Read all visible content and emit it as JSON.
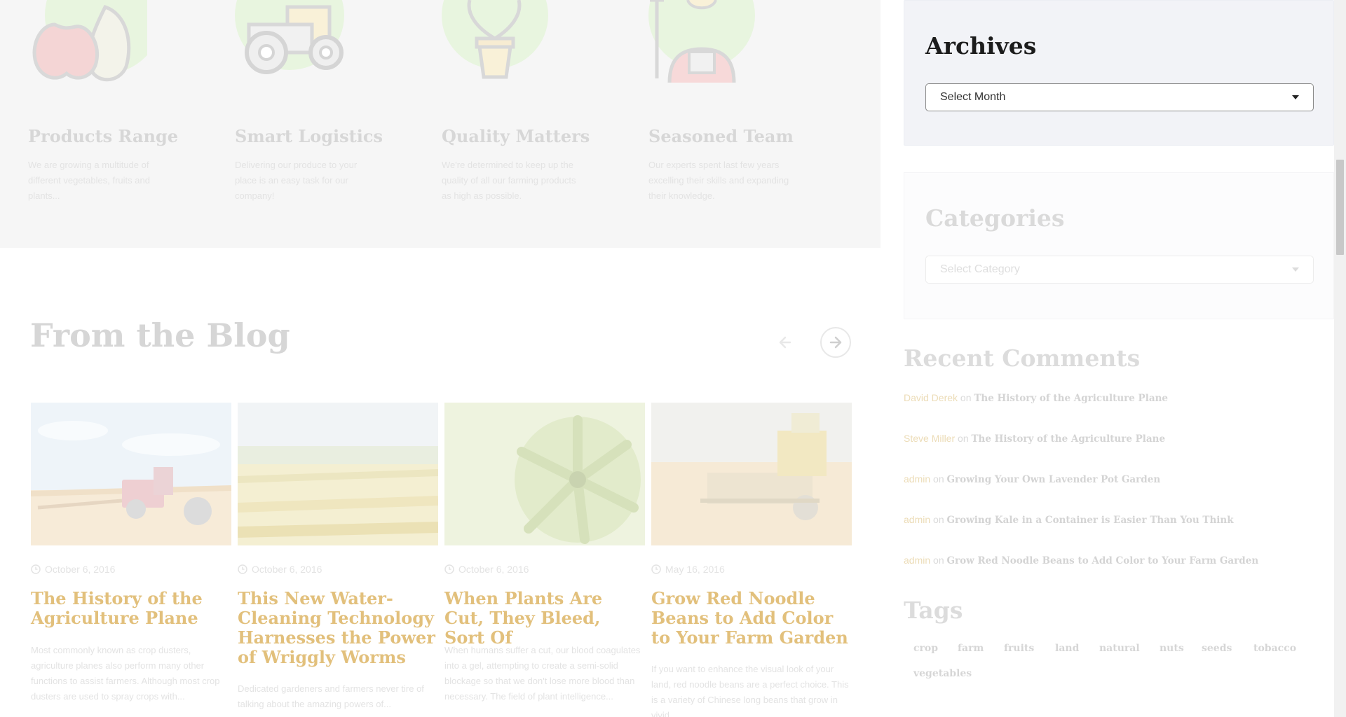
{
  "features": [
    {
      "icon": "fruit-icon",
      "title": "Products Range",
      "text": "We are growing a multitude of different vegetables, fruits and plants..."
    },
    {
      "icon": "tractor-icon",
      "title": "Smart Logistics",
      "text": "Delivering our produce to your place is an easy task for our company!"
    },
    {
      "icon": "potted-plant-icon",
      "title": "Quality Matters",
      "text": "We're determined to keep up the quality of all our farming products as high as possible."
    },
    {
      "icon": "farmer-icon",
      "title": "Seasoned Team",
      "text": "Our experts spent last few years excelling their skills and expanding their knowledge."
    }
  ],
  "blog": {
    "title": "From the Blog",
    "posts": [
      {
        "date": "October 6, 2016",
        "title": "The History of the Agriculture Plane",
        "excerpt": "Most commonly known as crop dusters, agriculture planes also perform many other functions to assist farmers. Although most crop dusters are used to spray crops with..."
      },
      {
        "date": "October 6, 2016",
        "title": "This New Water-Cleaning Technology Harnesses the Power of Wriggly Worms",
        "excerpt": "Dedicated gardeners and farmers never tire of talking about the amazing powers of..."
      },
      {
        "date": "October 6, 2016",
        "title": "When Plants Are Cut, They Bleed, Sort Of",
        "excerpt": "When humans suffer a cut, our blood coagulates into a gel, attempting to create a semi-solid blockage so that we don't lose more blood than necessary. The field of plant intelligence..."
      },
      {
        "date": "May 16, 2016",
        "title": "Grow Red Noodle Beans to Add Color to Your Farm Garden",
        "excerpt": "If you want to enhance the visual look of your land, red noodle beans are a perfect choice. This is a variety of Chinese long beans that grow in vivid..."
      }
    ]
  },
  "sidebar": {
    "archives": {
      "title": "Archives",
      "select_value": "Select Month"
    },
    "categories": {
      "title": "Categories",
      "select_value": "Select Category"
    },
    "recent_comments": {
      "title": "Recent Comments",
      "connector": "on",
      "items": [
        {
          "author": "David Derek",
          "post": "The History of the Agriculture Plane"
        },
        {
          "author": "Steve Miller",
          "post": "The History of the Agriculture Plane"
        },
        {
          "author": "admin",
          "post": "Growing Your Own Lavender Pot Garden"
        },
        {
          "author": "admin",
          "post": "Growing Kale in a Container is Easier Than You Think"
        },
        {
          "author": "admin",
          "post": "Grow Red Noodle Beans to Add Color to Your Farm Garden"
        }
      ]
    },
    "tags": {
      "title": "Tags",
      "items": [
        "crop",
        "farm",
        "fruits",
        "land",
        "natural",
        "nuts",
        "seeds",
        "tobacco",
        "vegetables"
      ]
    }
  },
  "colors": {
    "accent_gold": "#e2c07c",
    "sidebar_widget_bg": "#f2f3f7",
    "icon_green": "#e8f5df"
  }
}
